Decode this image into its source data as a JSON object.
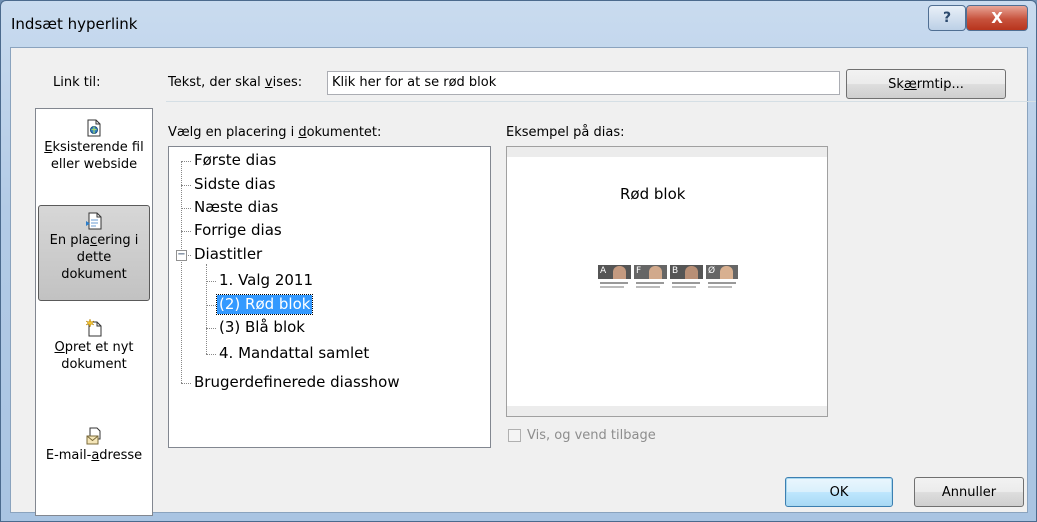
{
  "window": {
    "title": "Indsæt hyperlink",
    "help_glyph": "?",
    "close_glyph": "X"
  },
  "link_to": {
    "label": "Link til:",
    "items": [
      {
        "line1_u": "E",
        "line1_rest": "ksisterende fil",
        "line2": "eller webside",
        "icon": "existing-file-icon"
      },
      {
        "line1_pre": "En pla",
        "line1_u": "c",
        "line1_post": "ering i",
        "line2": "dette",
        "line3": "dokument",
        "icon": "place-in-document-icon",
        "selected": true
      },
      {
        "line1_u": "O",
        "line1_rest": "pret et nyt",
        "line2": "dokument",
        "icon": "new-document-icon"
      },
      {
        "line1_pre": "E-mail-",
        "line1_u": "a",
        "line1_post": "dresse",
        "icon": "email-icon"
      }
    ]
  },
  "text_to_display": {
    "label_pre": "Tekst, der skal ",
    "label_u": "v",
    "label_post": "ises:",
    "value": "Klik her for at se rød blok"
  },
  "screentip": {
    "pre": "Sk",
    "u": "æ",
    "post": "rmtip..."
  },
  "place_label": {
    "pre": "Vælg en placering i ",
    "u": "d",
    "post": "okumentet:"
  },
  "tree": {
    "first": "Første dias",
    "last": "Sidste dias",
    "next": "Næste dias",
    "previous": "Forrige dias",
    "titles": "Diastitler",
    "expander": "−",
    "children": [
      "1. Valg 2011",
      "(2) Rød blok",
      "(3) Blå blok",
      "4. Mandattal samlet"
    ],
    "custom": "Brugerdefinerede diasshow"
  },
  "preview": {
    "label": "Eksempel på dias:",
    "slide_title": "Rød blok",
    "portrait_letters": [
      "A",
      "F",
      "B",
      "Ø"
    ]
  },
  "show_return": {
    "label": "Vis, og vend tilbage",
    "checked": false
  },
  "buttons": {
    "ok": "OK",
    "cancel": "Annuller"
  },
  "colors": {
    "selection": "#3399ff",
    "title_bar": "#b3cbe6",
    "close_red": "#c7523c"
  }
}
